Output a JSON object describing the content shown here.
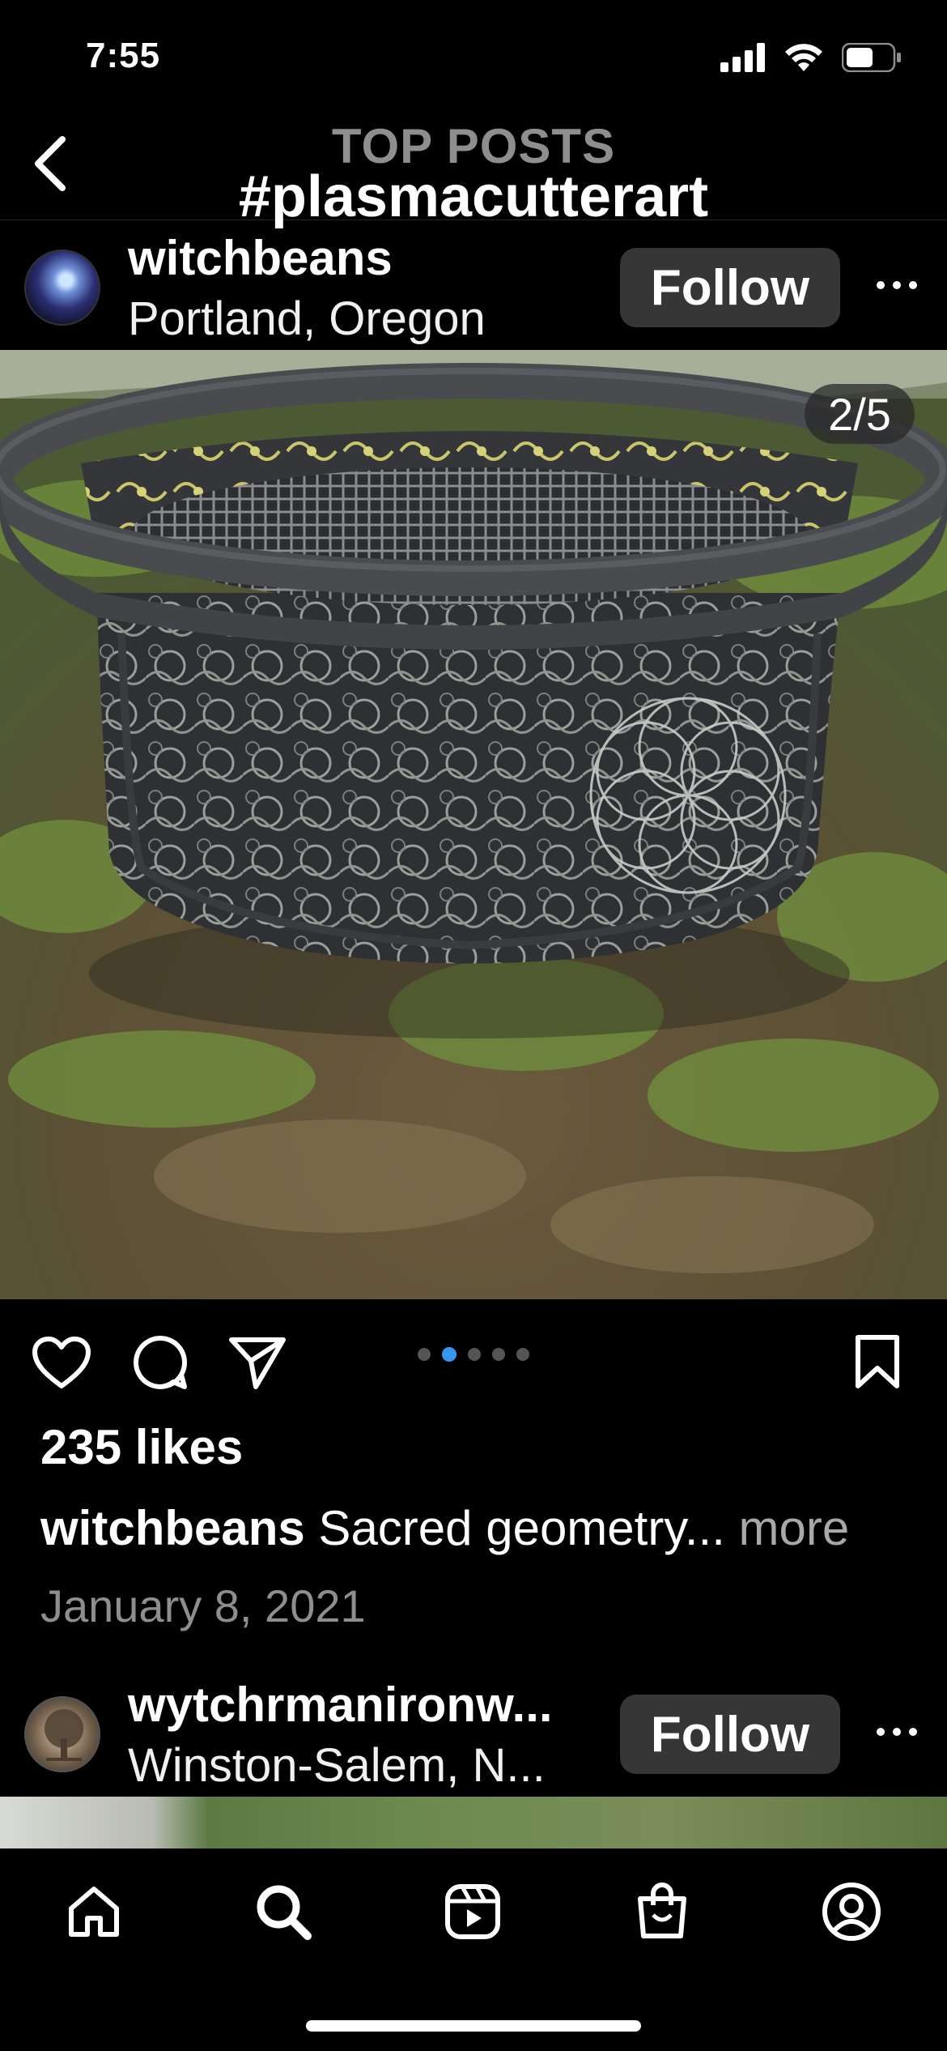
{
  "status_bar": {
    "time": "7:55"
  },
  "header": {
    "eyebrow": "TOP POSTS",
    "title": "#plasmacutterart"
  },
  "post1": {
    "username": "witchbeans",
    "location": "Portland, Oregon",
    "follow_label": "Follow",
    "photo_counter": "2/5",
    "carousel": {
      "count": 5,
      "active_index": 1
    },
    "likes": "235 likes",
    "caption_user": "witchbeans",
    "caption_text": "Sacred geometry...",
    "caption_more": "more",
    "date": "January 8, 2021"
  },
  "post2": {
    "username": "wytchrmanironw...",
    "location": "Winston-Salem, N...",
    "follow_label": "Follow"
  },
  "icons": {
    "back": "chevron-left-icon",
    "like": "heart-icon",
    "comment": "comment-icon",
    "share": "paper-plane-icon",
    "save": "bookmark-icon",
    "more": "more-horizontal-icon",
    "tabs": [
      "home-icon",
      "search-icon",
      "reels-icon",
      "shop-icon",
      "profile-icon"
    ]
  },
  "colors": {
    "background": "#000000",
    "follow_button": "#363636",
    "carousel_active": "#3797f0",
    "muted_text": "#8e8e8e"
  }
}
